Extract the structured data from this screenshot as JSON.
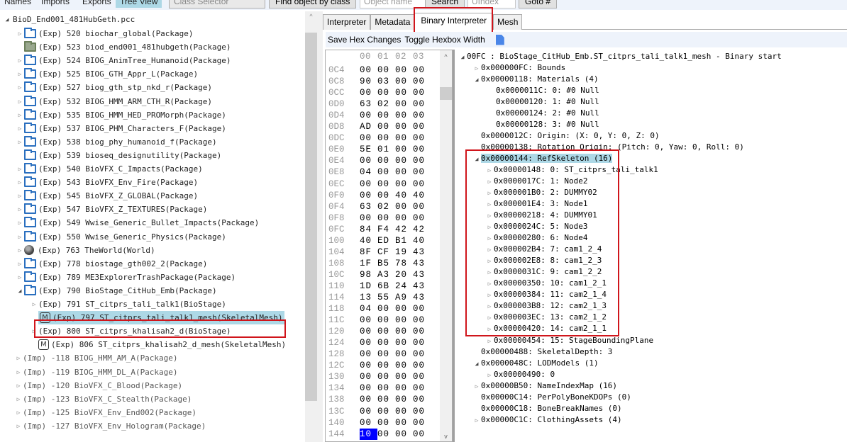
{
  "toolbar": {
    "tabs": [
      "Names",
      "Imports",
      "Exports",
      "Tree View"
    ],
    "active_tab": "Tree View",
    "class_selector_placeholder": "Class Selector",
    "find_by_class_label": "Find object by class",
    "object_name_placeholder": "Object name",
    "search_label": "Search",
    "uindex_placeholder": "UIndex",
    "goto_label": "Goto #"
  },
  "tree": {
    "root": "BioD_End001_481HubGeth.pcc",
    "items": [
      {
        "text": "(Exp) 520 biochar_global(Package)",
        "icon": "folder-icon",
        "arrow": "collapsed",
        "level": 1
      },
      {
        "text": "(Exp) 523 biod_end001_481hubgeth(Package)",
        "icon": "folder-filled-icon",
        "arrow": "none",
        "level": 1
      },
      {
        "text": "(Exp) 524 BIOG_AnimTree_Humanoid(Package)",
        "icon": "folder-icon",
        "arrow": "collapsed",
        "level": 1
      },
      {
        "text": "(Exp) 525 BIOG_GTH_Appr_L(Package)",
        "icon": "folder-icon",
        "arrow": "collapsed",
        "level": 1
      },
      {
        "text": "(Exp) 527 biog_gth_stp_nkd_r(Package)",
        "icon": "folder-icon",
        "arrow": "collapsed",
        "level": 1
      },
      {
        "text": "(Exp) 532 BIOG_HMM_ARM_CTH_R(Package)",
        "icon": "folder-icon",
        "arrow": "collapsed",
        "level": 1
      },
      {
        "text": "(Exp) 535 BIOG_HMM_HED_PROMorph(Package)",
        "icon": "folder-icon",
        "arrow": "collapsed",
        "level": 1
      },
      {
        "text": "(Exp) 537 BIOG_PHM_Characters_F(Package)",
        "icon": "folder-icon",
        "arrow": "collapsed",
        "level": 1
      },
      {
        "text": "(Exp) 538 biog_phy_humanoid_f(Package)",
        "icon": "folder-icon",
        "arrow": "collapsed",
        "level": 1
      },
      {
        "text": "(Exp) 539 bioseq_designutility(Package)",
        "icon": "folder-icon",
        "arrow": "none",
        "level": 1
      },
      {
        "text": "(Exp) 540 BioVFX_C_Impacts(Package)",
        "icon": "folder-icon",
        "arrow": "collapsed",
        "level": 1
      },
      {
        "text": "(Exp) 543 BioVFX_Env_Fire(Package)",
        "icon": "folder-icon",
        "arrow": "collapsed",
        "level": 1
      },
      {
        "text": "(Exp) 545 BioVFX_Z_GLOBAL(Package)",
        "icon": "folder-icon",
        "arrow": "collapsed",
        "level": 1
      },
      {
        "text": "(Exp) 547 BioVFX_Z_TEXTURES(Package)",
        "icon": "folder-icon",
        "arrow": "collapsed",
        "level": 1
      },
      {
        "text": "(Exp) 549 Wwise_Generic_Bullet_Impacts(Package)",
        "icon": "folder-icon",
        "arrow": "collapsed",
        "level": 1
      },
      {
        "text": "(Exp) 550 Wwise_Generic_Physics(Package)",
        "icon": "folder-icon",
        "arrow": "collapsed",
        "level": 1
      },
      {
        "text": "(Exp) 763 TheWorld(World)",
        "icon": "globe-icon",
        "arrow": "collapsed",
        "level": 1
      },
      {
        "text": "(Exp) 778 biostage_gth002_2(Package)",
        "icon": "folder-icon",
        "arrow": "collapsed",
        "level": 1
      },
      {
        "text": "(Exp) 789 ME3ExplorerTrashPackage(Package)",
        "icon": "folder-icon",
        "arrow": "collapsed",
        "level": 1
      },
      {
        "text": "(Exp) 790 BioStage_CitHub_Emb(Package)",
        "icon": "folder-icon",
        "arrow": "expanded",
        "level": 1
      },
      {
        "text": "(Exp) 791 ST_citprs_tali_talk1(BioStage)",
        "icon": "none",
        "arrow": "collapsed",
        "level": 2
      },
      {
        "text": "(Exp) 797 ST_citprs_tali_talk1_mesh(SkeletalMesh)",
        "icon": "mesh-icon",
        "arrow": "none",
        "level": 2,
        "selected": true
      },
      {
        "text": "(Exp) 800 ST_citprs_khalisah2_d(BioStage)",
        "icon": "none",
        "arrow": "collapsed",
        "level": 2
      },
      {
        "text": "(Exp) 806 ST_citprs_khalisah2_d_mesh(SkeletalMesh)",
        "icon": "mesh-icon",
        "arrow": "none",
        "level": 2
      },
      {
        "text": "(Imp) -118 BIOG_HMM_AM_A(Package)",
        "icon": "none",
        "arrow": "collapsed",
        "level": 0,
        "imp": true
      },
      {
        "text": "(Imp) -119 BIOG_HMM_DL_A(Package)",
        "icon": "none",
        "arrow": "collapsed",
        "level": 0,
        "imp": true
      },
      {
        "text": "(Imp) -120 BioVFX_C_Blood(Package)",
        "icon": "none",
        "arrow": "collapsed",
        "level": 0,
        "imp": true
      },
      {
        "text": "(Imp) -123 BioVFX_C_Stealth(Package)",
        "icon": "none",
        "arrow": "collapsed",
        "level": 0,
        "imp": true
      },
      {
        "text": "(Imp) -125 BioVFX_Env_End002(Package)",
        "icon": "none",
        "arrow": "collapsed",
        "level": 0,
        "imp": true
      },
      {
        "text": "(Imp) -127 BioVFX_Env_Hologram(Package)",
        "icon": "none",
        "arrow": "collapsed",
        "level": 0,
        "imp": true
      }
    ]
  },
  "editor": {
    "tabs": [
      "Interpreter",
      "Metadata",
      "Binary Interpreter",
      "Mesh"
    ],
    "active_tab": "Binary Interpreter",
    "save_hex_label": "Save Hex Changes",
    "toggle_hexbox_label": "Toggle Hexbox Width"
  },
  "hex": {
    "header": [
      "00",
      "01",
      "02",
      "03"
    ],
    "rows": [
      {
        "addr": "0C4",
        "bytes": [
          "00",
          "00",
          "00",
          "00"
        ]
      },
      {
        "addr": "0C8",
        "bytes": [
          "90",
          "03",
          "00",
          "00"
        ]
      },
      {
        "addr": "0CC",
        "bytes": [
          "00",
          "00",
          "00",
          "00"
        ]
      },
      {
        "addr": "0D0",
        "bytes": [
          "63",
          "02",
          "00",
          "00"
        ]
      },
      {
        "addr": "0D4",
        "bytes": [
          "00",
          "00",
          "00",
          "00"
        ]
      },
      {
        "addr": "0D8",
        "bytes": [
          "AD",
          "00",
          "00",
          "00"
        ]
      },
      {
        "addr": "0DC",
        "bytes": [
          "00",
          "00",
          "00",
          "00"
        ]
      },
      {
        "addr": "0E0",
        "bytes": [
          "5E",
          "01",
          "00",
          "00"
        ]
      },
      {
        "addr": "0E4",
        "bytes": [
          "00",
          "00",
          "00",
          "00"
        ]
      },
      {
        "addr": "0E8",
        "bytes": [
          "04",
          "00",
          "00",
          "00"
        ]
      },
      {
        "addr": "0EC",
        "bytes": [
          "00",
          "00",
          "00",
          "00"
        ]
      },
      {
        "addr": "0F0",
        "bytes": [
          "00",
          "00",
          "40",
          "40"
        ]
      },
      {
        "addr": "0F4",
        "bytes": [
          "63",
          "02",
          "00",
          "00"
        ]
      },
      {
        "addr": "0F8",
        "bytes": [
          "00",
          "00",
          "00",
          "00"
        ]
      },
      {
        "addr": "0FC",
        "bytes": [
          "84",
          "F4",
          "42",
          "42"
        ]
      },
      {
        "addr": "100",
        "bytes": [
          "40",
          "ED",
          "B1",
          "40"
        ]
      },
      {
        "addr": "104",
        "bytes": [
          "8F",
          "CF",
          "19",
          "43"
        ]
      },
      {
        "addr": "108",
        "bytes": [
          "1F",
          "B5",
          "78",
          "43"
        ]
      },
      {
        "addr": "10C",
        "bytes": [
          "98",
          "A3",
          "20",
          "43"
        ]
      },
      {
        "addr": "110",
        "bytes": [
          "1D",
          "6B",
          "24",
          "43"
        ]
      },
      {
        "addr": "114",
        "bytes": [
          "13",
          "55",
          "A9",
          "43"
        ]
      },
      {
        "addr": "118",
        "bytes": [
          "04",
          "00",
          "00",
          "00"
        ]
      },
      {
        "addr": "11C",
        "bytes": [
          "00",
          "00",
          "00",
          "00"
        ]
      },
      {
        "addr": "120",
        "bytes": [
          "00",
          "00",
          "00",
          "00"
        ]
      },
      {
        "addr": "124",
        "bytes": [
          "00",
          "00",
          "00",
          "00"
        ]
      },
      {
        "addr": "128",
        "bytes": [
          "00",
          "00",
          "00",
          "00"
        ]
      },
      {
        "addr": "12C",
        "bytes": [
          "00",
          "00",
          "00",
          "00"
        ]
      },
      {
        "addr": "130",
        "bytes": [
          "00",
          "00",
          "00",
          "00"
        ]
      },
      {
        "addr": "134",
        "bytes": [
          "00",
          "00",
          "00",
          "00"
        ]
      },
      {
        "addr": "138",
        "bytes": [
          "00",
          "00",
          "00",
          "00"
        ]
      },
      {
        "addr": "13C",
        "bytes": [
          "00",
          "00",
          "00",
          "00"
        ]
      },
      {
        "addr": "140",
        "bytes": [
          "00",
          "00",
          "00",
          "00"
        ]
      },
      {
        "addr": "144",
        "bytes": [
          "10",
          "00",
          "00",
          "00"
        ],
        "highlight": 0
      }
    ]
  },
  "binary_tree": {
    "items": [
      {
        "text": "00FC : BioStage_CitHub_Emb.ST_citprs_tali_talk1_mesh - Binary start",
        "level": 0,
        "arrow": "expanded"
      },
      {
        "text": "0x000000FC: Bounds",
        "level": 1,
        "arrow": "collapsed"
      },
      {
        "text": "0x00000118: Materials (4)",
        "level": 1,
        "arrow": "expanded"
      },
      {
        "text": "0x0000011C: 0: #0 Null",
        "level": 2,
        "arrow": "none"
      },
      {
        "text": "0x00000120: 1: #0 Null",
        "level": 2,
        "arrow": "none"
      },
      {
        "text": "0x00000124: 2: #0 Null",
        "level": 2,
        "arrow": "none"
      },
      {
        "text": "0x00000128: 3: #0 Null",
        "level": 2,
        "arrow": "none"
      },
      {
        "text": "0x0000012C: Origin: (X: 0, Y: 0, Z: 0)",
        "level": 1,
        "arrow": "none"
      },
      {
        "text": "0x00000138: Rotation Origin: (Pitch: 0, Yaw: 0, Roll: 0)",
        "level": 1,
        "arrow": "none"
      },
      {
        "text": "0x00000144: RefSkeleton (16)",
        "level": 1,
        "arrow": "expanded",
        "selected": true
      },
      {
        "text": "0x00000148: 0: ST_citprs_tali_talk1",
        "level": 2,
        "arrow": "collapsed"
      },
      {
        "text": "0x0000017C: 1: Node2",
        "level": 2,
        "arrow": "collapsed"
      },
      {
        "text": "0x000001B0: 2: DUMMY02",
        "level": 2,
        "arrow": "collapsed"
      },
      {
        "text": "0x000001E4: 3: Node1",
        "level": 2,
        "arrow": "collapsed"
      },
      {
        "text": "0x00000218: 4: DUMMY01",
        "level": 2,
        "arrow": "collapsed"
      },
      {
        "text": "0x0000024C: 5: Node3",
        "level": 2,
        "arrow": "collapsed"
      },
      {
        "text": "0x00000280: 6: Node4",
        "level": 2,
        "arrow": "collapsed"
      },
      {
        "text": "0x000002B4: 7: cam1_2_4",
        "level": 2,
        "arrow": "collapsed"
      },
      {
        "text": "0x000002E8: 8: cam1_2_3",
        "level": 2,
        "arrow": "collapsed"
      },
      {
        "text": "0x0000031C: 9: cam1_2_2",
        "level": 2,
        "arrow": "collapsed"
      },
      {
        "text": "0x00000350: 10: cam1_2_1",
        "level": 2,
        "arrow": "collapsed"
      },
      {
        "text": "0x00000384: 11: cam2_1_4",
        "level": 2,
        "arrow": "collapsed"
      },
      {
        "text": "0x000003B8: 12: cam2_1_3",
        "level": 2,
        "arrow": "collapsed"
      },
      {
        "text": "0x000003EC: 13: cam2_1_2",
        "level": 2,
        "arrow": "collapsed"
      },
      {
        "text": "0x00000420: 14: cam2_1_1",
        "level": 2,
        "arrow": "collapsed"
      },
      {
        "text": "0x00000454: 15: StageBoundingPlane",
        "level": 2,
        "arrow": "collapsed"
      },
      {
        "text": "0x00000488: SkeletalDepth: 3",
        "level": 1,
        "arrow": "none"
      },
      {
        "text": "0x0000048C: LODModels (1)",
        "level": 1,
        "arrow": "expanded"
      },
      {
        "text": "0x00000490: 0",
        "level": 2,
        "arrow": "collapsed"
      },
      {
        "text": "0x00000B50: NameIndexMap (16)",
        "level": 1,
        "arrow": "collapsed"
      },
      {
        "text": "0x00000C14: PerPolyBoneKDOPs (0)",
        "level": 1,
        "arrow": "none"
      },
      {
        "text": "0x00000C18: BoneBreakNames (0)",
        "level": 1,
        "arrow": "none"
      },
      {
        "text": "0x00000C1C: ClothingAssets (4)",
        "level": 1,
        "arrow": "collapsed"
      }
    ]
  },
  "colors": {
    "selection": "#add8e6",
    "annotation_box": "#d0151b",
    "hex_highlight": "#0000ff",
    "folder": "#2a6fbf"
  }
}
